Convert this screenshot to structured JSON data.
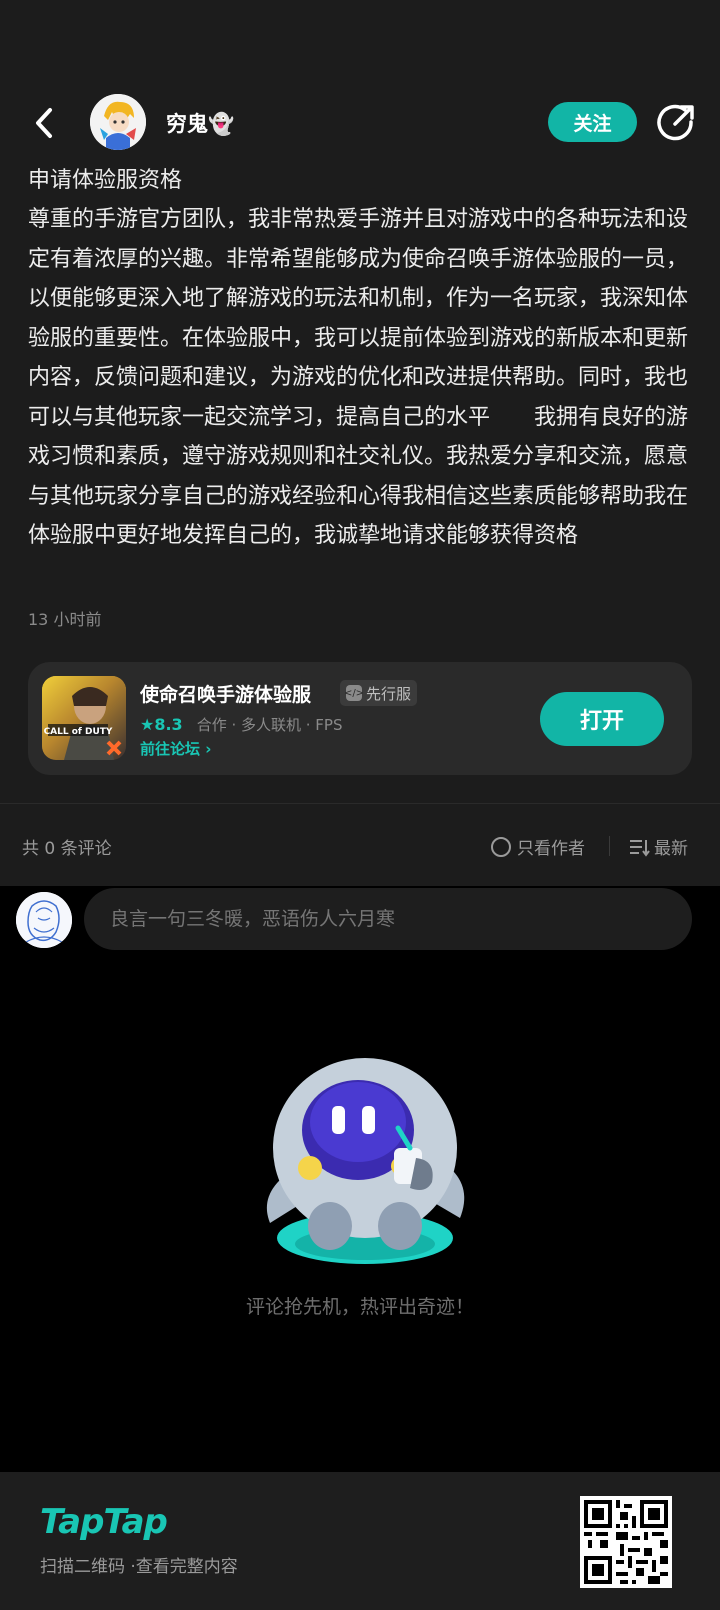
{
  "header": {
    "username": "穷鬼👻",
    "follow_label": "关注"
  },
  "post": {
    "title": "申请体验服资格",
    "body": "尊重的手游官方团队，我非常热爱手游并且对游戏中的各种玩法和设定有着浓厚的兴趣。非常希望能够成为使命召唤手游体验服的一员，以便能够更深入地了解游戏的玩法和机制，作为一名玩家，我深知体验服的重要性。在体验服中，我可以提前体验到游戏的新版本和更新内容，反馈问题和建议，为游戏的优化和改进提供帮助。同时，我也可以与其他玩家一起交流学习，提高自己的水平　　我拥有良好的游戏习惯和素质，遵守游戏规则和社交礼仪。我热爱分享和交流，愿意与其他玩家分享自己的游戏经验和心得我相信这些素质能够帮助我在体验服中更好地发挥自己的，我诚挚地请求能够获得资格",
    "time": "13 小时前"
  },
  "game_card": {
    "name": "使命召唤手游体验服",
    "badge": "先行服",
    "rating": "8.3",
    "tags": "合作 · 多人联机 · FPS",
    "forum_link": "前往论坛",
    "open_label": "打开",
    "icon_text": "CALL of DUTY"
  },
  "comments": {
    "count_label": "共 0 条评论",
    "only_author_label": "只看作者",
    "sort_label": "最新",
    "input_placeholder": "良言一句三冬暖，恶语伤人六月寒",
    "empty_text": "评论抢先机，热评出奇迹！"
  },
  "footer": {
    "logo": "TapTap",
    "hint": "扫描二维码 ·查看完整内容"
  },
  "colors": {
    "accent": "#12b5a6",
    "background": "#1c1c1c",
    "card": "#2a2a2a"
  }
}
